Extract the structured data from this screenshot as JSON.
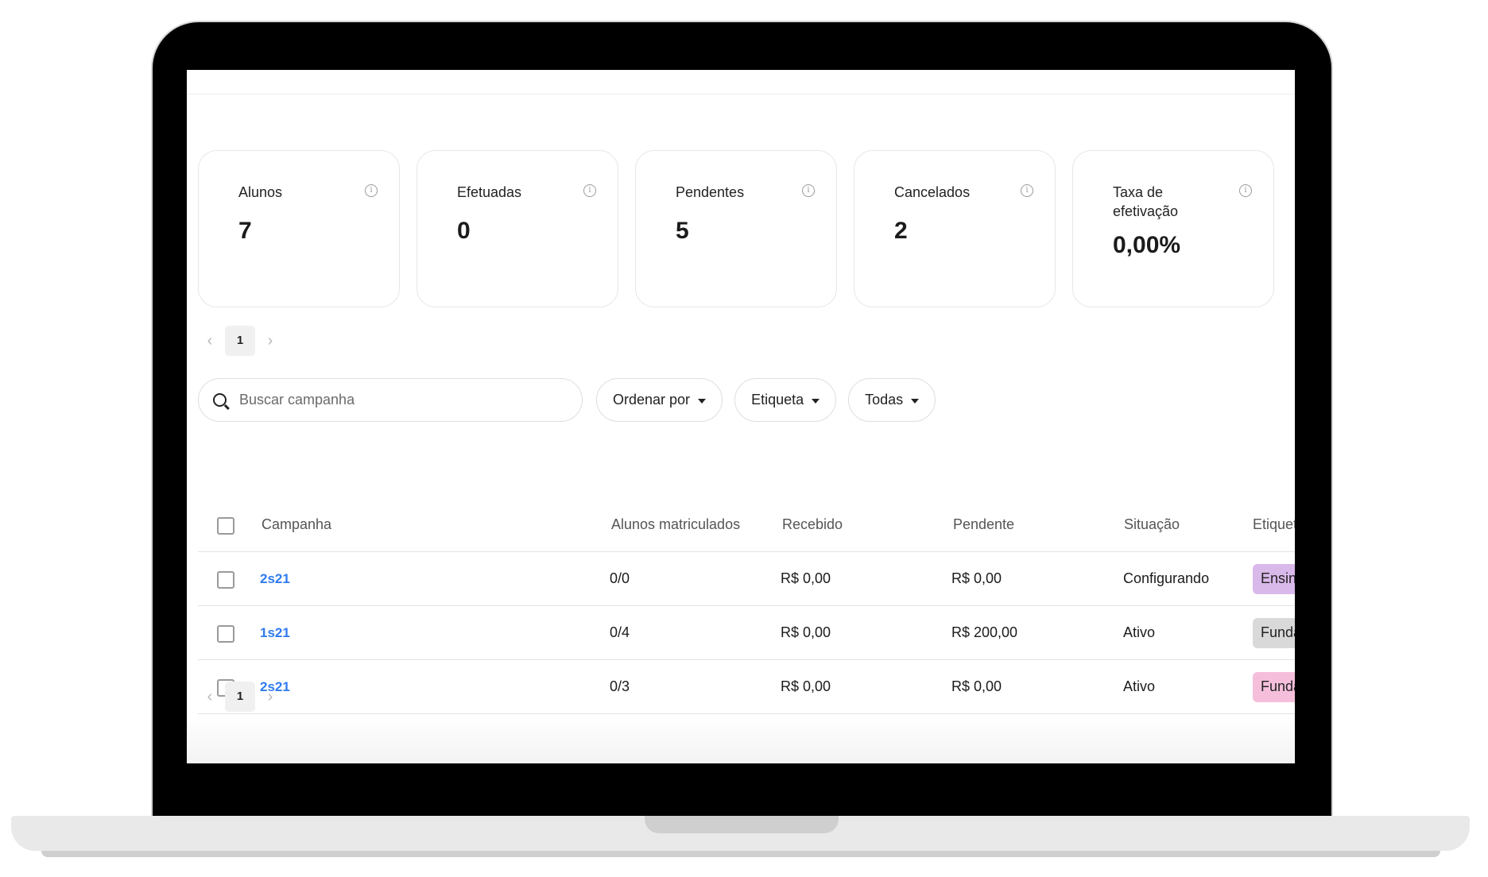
{
  "stats": [
    {
      "label": "Alunos",
      "value": "7"
    },
    {
      "label": "Efetuadas",
      "value": "0"
    },
    {
      "label": "Pendentes",
      "value": "5"
    },
    {
      "label": "Cancelados",
      "value": "2"
    },
    {
      "label": "Taxa de efetivação",
      "value": "0,00%"
    }
  ],
  "pagination_top": {
    "current": "1",
    "prev_icon": "chevron-left-icon",
    "next_icon": "chevron-right-icon"
  },
  "search": {
    "placeholder": "Buscar campanha"
  },
  "filters": {
    "sort_label": "Ordenar por",
    "tag_label": "Etiqueta",
    "status_label": "Todas"
  },
  "table": {
    "headers": {
      "campaign": "Campanha",
      "enrolled": "Alunos matriculados",
      "received": "Recebido",
      "pending": "Pendente",
      "status": "Situação",
      "tag": "Etiqueta"
    },
    "rows": [
      {
        "campaign": "2s21",
        "enrolled": "0/0",
        "received": "R$ 0,00",
        "pending": "R$ 0,00",
        "status": "Configurando",
        "tag": "Ensino",
        "tag_color": "#d9b8ea"
      },
      {
        "campaign": "1s21",
        "enrolled": "0/4",
        "received": "R$ 0,00",
        "pending": "R$ 200,00",
        "status": "Ativo",
        "tag": "Fundar",
        "tag_color": "#d9d9d9"
      },
      {
        "campaign": "2s21",
        "enrolled": "0/3",
        "received": "R$ 0,00",
        "pending": "R$ 0,00",
        "status": "Ativo",
        "tag": "Fundar",
        "tag_color": "#f5bfdc"
      }
    ]
  },
  "pagination_bottom": {
    "current": "1"
  },
  "colors": {
    "link": "#2f7bf0",
    "card_border": "#e7e7e7"
  }
}
